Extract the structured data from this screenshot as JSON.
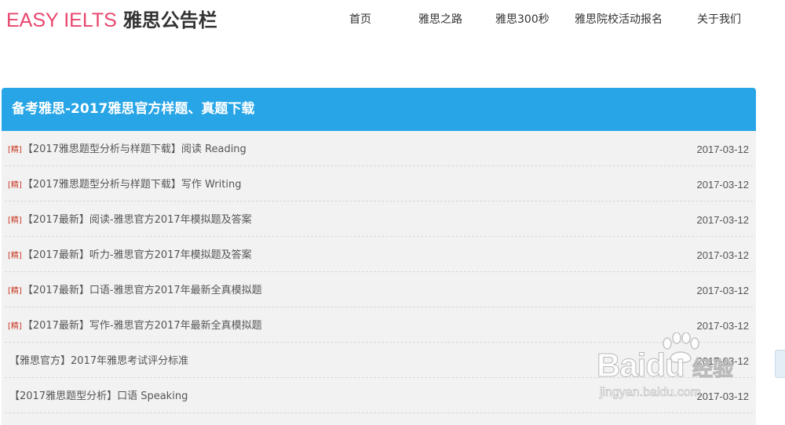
{
  "header": {
    "logo_en": "EASY IELTS",
    "logo_cn": "雅思公告栏",
    "nav": [
      {
        "label": "首页"
      },
      {
        "label": "雅思之路"
      },
      {
        "label": "雅思300秒"
      },
      {
        "label": "雅思院校活动报名"
      },
      {
        "label": "关于我们"
      }
    ]
  },
  "panel": {
    "title": "备考雅思-2017雅思官方样题、真题下载",
    "items": [
      {
        "badge": "[精]",
        "title": "【2017雅思题型分析与样题下载】阅读 Reading",
        "date": "2017-03-12"
      },
      {
        "badge": "[精]",
        "title": "【2017雅思题型分析与样题下载】写作 Writing",
        "date": "2017-03-12"
      },
      {
        "badge": "[精]",
        "title": "【2017最新】阅读-雅思官方2017年模拟题及答案",
        "date": "2017-03-12"
      },
      {
        "badge": "[精]",
        "title": "【2017最新】听力-雅思官方2017年模拟题及答案",
        "date": "2017-03-12"
      },
      {
        "badge": "[精]",
        "title": "【2017最新】口语-雅思官方2017年最新全真模拟题",
        "date": "2017-03-12"
      },
      {
        "badge": "[精]",
        "title": "【2017最新】写作-雅思官方2017年最新全真模拟题",
        "date": "2017-03-12"
      },
      {
        "badge": "",
        "title": "【雅思官方】2017年雅思考试评分标准",
        "date": "2017-03-12"
      },
      {
        "badge": "",
        "title": "【2017雅思题型分析】口语 Speaking",
        "date": "2017-03-12"
      }
    ]
  },
  "watermark": {
    "brand": "Baidu",
    "cn": "经验",
    "url": "jingyan.baidu.com"
  },
  "colors": {
    "logo_accent": "#e8466d",
    "panel_header": "#27a5e6",
    "badge": "#c7341f"
  }
}
